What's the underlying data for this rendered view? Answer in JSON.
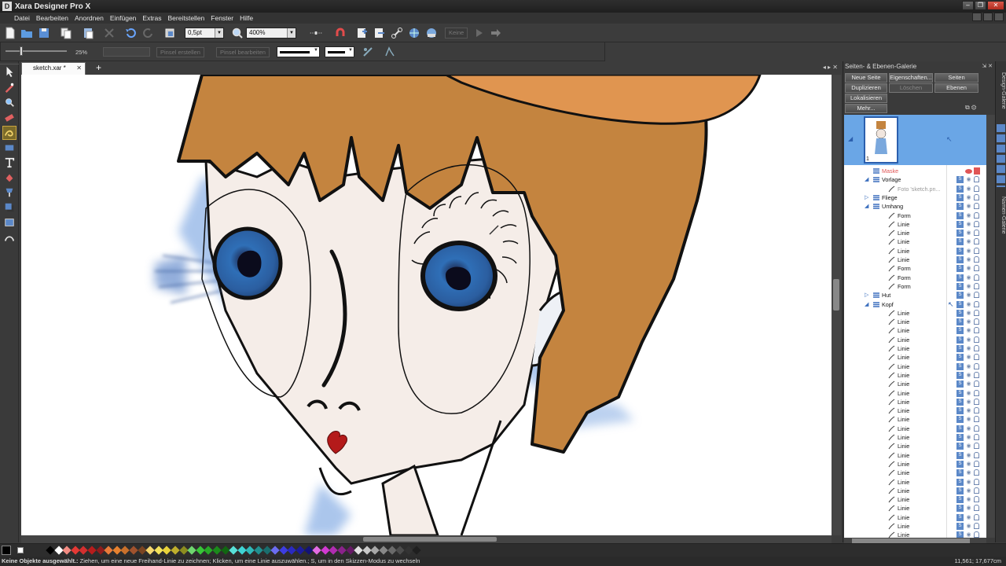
{
  "app": {
    "title": "Xara Designer Pro X"
  },
  "menu": [
    "Datei",
    "Bearbeiten",
    "Anordnen",
    "Einfügen",
    "Extras",
    "Bereitstellen",
    "Fenster",
    "Hilfe"
  ],
  "toolbar": {
    "line_width": "0,5pt",
    "zoom": "400%",
    "keine_label": "Keine",
    "smoothing_value": "25%",
    "brush_create": "Pinsel erstellen",
    "brush_edit": "Pinsel bearbeiten"
  },
  "document": {
    "tab": "sketch.xar *"
  },
  "gallery": {
    "title": "Seiten- & Ebenen-Galerie",
    "buttons": {
      "new_page": "Neue Seite",
      "properties": "Eigenschaften...",
      "pages": "Seiten",
      "duplicate": "Duplizieren",
      "delete": "Löschen",
      "layers": "Ebenen",
      "locate": "Lokalisieren",
      "more": "Mehr..."
    },
    "page_number": "1",
    "layers": [
      {
        "name": "Maske",
        "indent": 0,
        "type": "layer",
        "expand": "",
        "red": true
      },
      {
        "name": "Vorlage",
        "indent": 0,
        "type": "layer",
        "expand": "◢"
      },
      {
        "name": "Foto 'sketch.pn...",
        "indent": 2,
        "type": "object",
        "dim": true
      },
      {
        "name": "Fliege",
        "indent": 0,
        "type": "layer",
        "expand": "▷"
      },
      {
        "name": "Umhang",
        "indent": 0,
        "type": "layer",
        "expand": "◢"
      },
      {
        "name": "Form",
        "indent": 2,
        "type": "object"
      },
      {
        "name": "Linie",
        "indent": 2,
        "type": "object"
      },
      {
        "name": "Linie",
        "indent": 2,
        "type": "object"
      },
      {
        "name": "Linie",
        "indent": 2,
        "type": "object"
      },
      {
        "name": "Linie",
        "indent": 2,
        "type": "object"
      },
      {
        "name": "Linie",
        "indent": 2,
        "type": "object"
      },
      {
        "name": "Form",
        "indent": 2,
        "type": "object"
      },
      {
        "name": "Form",
        "indent": 2,
        "type": "object"
      },
      {
        "name": "Form",
        "indent": 2,
        "type": "object"
      },
      {
        "name": "Hut",
        "indent": 0,
        "type": "layer",
        "expand": "▷"
      },
      {
        "name": "Kopf",
        "indent": 0,
        "type": "layer",
        "expand": "◢"
      },
      {
        "name": "Linie",
        "indent": 2,
        "type": "object"
      },
      {
        "name": "Linie",
        "indent": 2,
        "type": "object"
      },
      {
        "name": "Linie",
        "indent": 2,
        "type": "object"
      },
      {
        "name": "Linie",
        "indent": 2,
        "type": "object"
      },
      {
        "name": "Linie",
        "indent": 2,
        "type": "object"
      },
      {
        "name": "Linie",
        "indent": 2,
        "type": "object"
      },
      {
        "name": "Linie",
        "indent": 2,
        "type": "object"
      },
      {
        "name": "Linie",
        "indent": 2,
        "type": "object"
      },
      {
        "name": "Linie",
        "indent": 2,
        "type": "object"
      },
      {
        "name": "Linie",
        "indent": 2,
        "type": "object"
      },
      {
        "name": "Linie",
        "indent": 2,
        "type": "object"
      },
      {
        "name": "Linie",
        "indent": 2,
        "type": "object"
      },
      {
        "name": "Linie",
        "indent": 2,
        "type": "object"
      },
      {
        "name": "Linie",
        "indent": 2,
        "type": "object"
      },
      {
        "name": "Linie",
        "indent": 2,
        "type": "object"
      },
      {
        "name": "Linie",
        "indent": 2,
        "type": "object"
      },
      {
        "name": "Linie",
        "indent": 2,
        "type": "object"
      },
      {
        "name": "Linie",
        "indent": 2,
        "type": "object"
      },
      {
        "name": "Linie",
        "indent": 2,
        "type": "object"
      },
      {
        "name": "Linie",
        "indent": 2,
        "type": "object"
      },
      {
        "name": "Linie",
        "indent": 2,
        "type": "object"
      },
      {
        "name": "Linie",
        "indent": 2,
        "type": "object"
      },
      {
        "name": "Linie",
        "indent": 2,
        "type": "object"
      },
      {
        "name": "Linie",
        "indent": 2,
        "type": "object"
      },
      {
        "name": "Linie",
        "indent": 2,
        "type": "object"
      },
      {
        "name": "Linie",
        "indent": 2,
        "type": "object"
      },
      {
        "name": "Linie",
        "indent": 2,
        "type": "object"
      }
    ]
  },
  "right_tabs": [
    "Design-Galerie",
    "Namen-Galerie"
  ],
  "palette": [
    "#000000",
    "#ffffff",
    "#f28b82",
    "#e53935",
    "#d32f2f",
    "#b71c1c",
    "#8e1c1c",
    "#e87b3a",
    "#e6812f",
    "#c9702b",
    "#a0522d",
    "#7a4421",
    "#f5d76e",
    "#f2e15a",
    "#e8d23a",
    "#bfae2c",
    "#8c8c1f",
    "#6fd66f",
    "#38c538",
    "#27a827",
    "#1b8a1b",
    "#116611",
    "#58e0d8",
    "#3fd4d4",
    "#2fb8b8",
    "#208f8f",
    "#1a6d6d",
    "#6c6cf0",
    "#3d3de0",
    "#2a2ac0",
    "#1c1c9a",
    "#131377",
    "#e36ce3",
    "#d13ad1",
    "#b02cb0",
    "#8a228a",
    "#661966",
    "#e0e0e0",
    "#c8c8c8",
    "#a8a8a8",
    "#888888",
    "#6a6a6a",
    "#4c4c4c",
    "#333333",
    "#1f1f1f"
  ],
  "status": {
    "bold": "Keine Objekte ausgewählt.:",
    "text": " Ziehen, um eine neue Freihand-Linie zu zeichnen; Klicken, um eine Linie auszuwählen.; S, um in den Skizzen-Modus zu wechseln",
    "coords": "11,561; 17,677cm"
  }
}
